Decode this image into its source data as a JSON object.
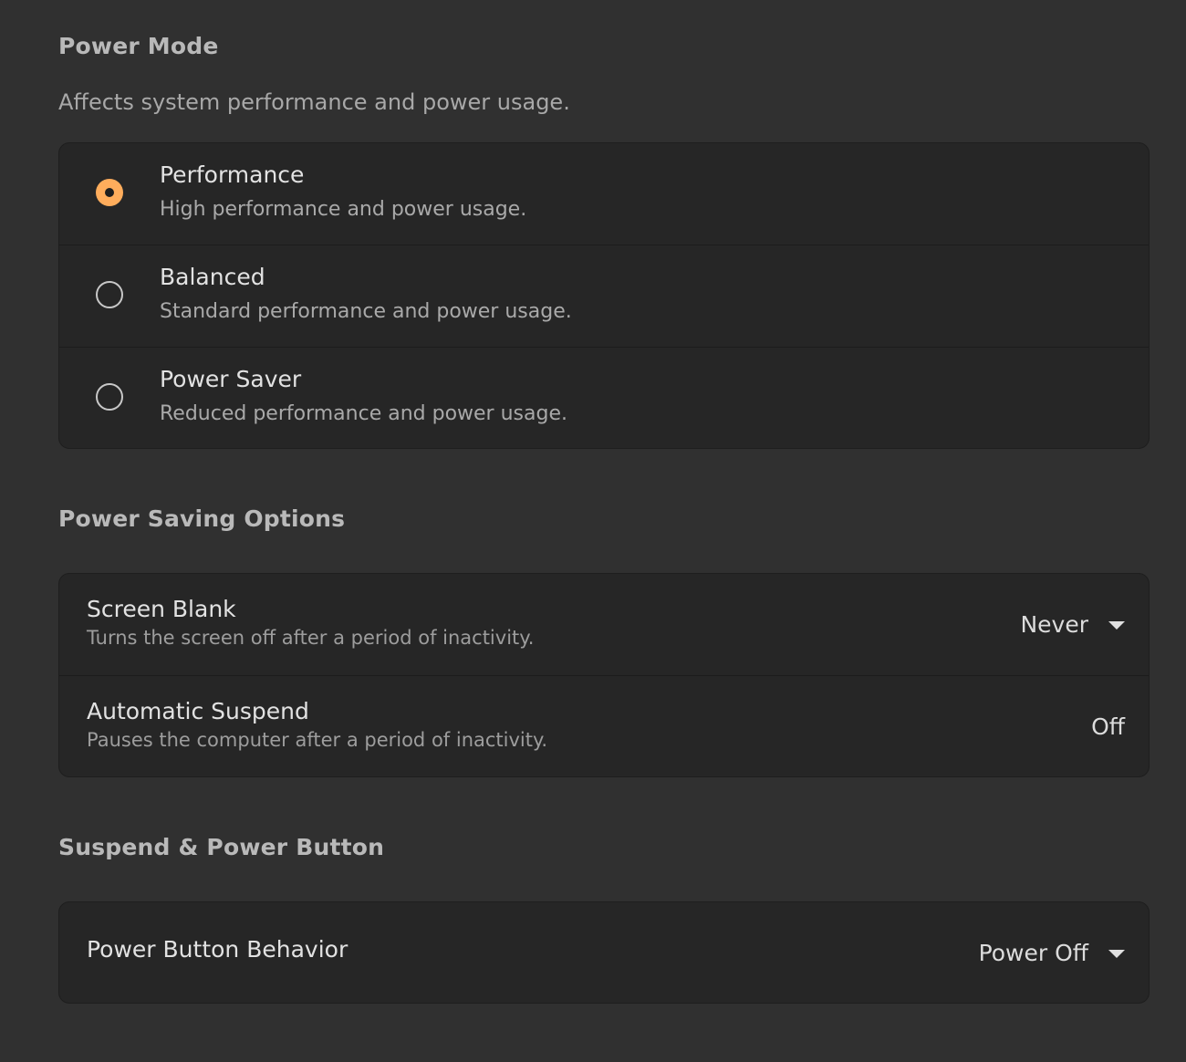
{
  "power_mode": {
    "title": "Power Mode",
    "description": "Affects system performance and power usage.",
    "options": [
      {
        "label": "Performance",
        "description": "High performance and power usage.",
        "selected": true
      },
      {
        "label": "Balanced",
        "description": "Standard performance and power usage.",
        "selected": false
      },
      {
        "label": "Power Saver",
        "description": "Reduced performance and power usage.",
        "selected": false
      }
    ]
  },
  "power_saving": {
    "title": "Power Saving Options",
    "screen_blank": {
      "label": "Screen Blank",
      "description": "Turns the screen off after a period of inactivity.",
      "value": "Never"
    },
    "automatic_suspend": {
      "label": "Automatic Suspend",
      "description": "Pauses the computer after a period of inactivity.",
      "value": "Off"
    }
  },
  "suspend_power_button": {
    "title": "Suspend & Power Button",
    "power_button_behavior": {
      "label": "Power Button Behavior",
      "value": "Power Off"
    }
  },
  "colors": {
    "accent": "#ffad5c",
    "background": "#303030",
    "card": "#262626"
  }
}
